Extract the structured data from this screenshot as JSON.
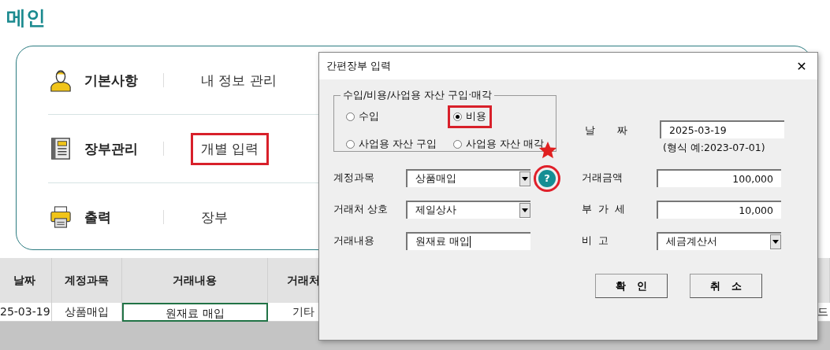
{
  "page_title": "메인",
  "menu": [
    {
      "kind": "person",
      "category": "기본사항",
      "item": "내 정보 관리",
      "highlighted": false
    },
    {
      "kind": "notebook",
      "category": "장부관리",
      "item": "개별 입력",
      "highlighted": true
    },
    {
      "kind": "printer",
      "category": "출력",
      "item": "장부",
      "highlighted": false
    }
  ],
  "sheet": {
    "columns": [
      "날짜",
      "계정과목",
      "거래내용",
      "거래처"
    ],
    "row": [
      {
        "text": "25-03-19",
        "selected": false
      },
      {
        "text": "상품매입",
        "selected": false
      },
      {
        "text": "원재료 매입",
        "selected": true
      },
      {
        "text": "기타",
        "selected": false
      }
    ],
    "right_cell": "드"
  },
  "dialog": {
    "title": "간편장부 입력",
    "close": "✕",
    "group": {
      "title": "수입/비용/사업용 자산 구입·매각",
      "options": [
        {
          "label": "수입",
          "selected": false,
          "highlighted": false
        },
        {
          "label": "비용",
          "selected": true,
          "highlighted": true
        },
        {
          "label": "사업용 자산 구입",
          "selected": false,
          "highlighted": false
        },
        {
          "label": "사업용 자산 매각",
          "selected": false,
          "highlighted": false
        }
      ]
    },
    "date": {
      "label": "날 짜",
      "value": "2025-03-19",
      "hint": "(형식 예:2023-07-01)"
    },
    "help": {
      "text": "?",
      "circled": true,
      "starred": true
    },
    "left_fields": [
      {
        "kind": "combo",
        "label": "계정과목",
        "value": "상품매입"
      },
      {
        "kind": "combo",
        "label": "거래처 상호",
        "value": "제일상사"
      },
      {
        "kind": "text",
        "label": "거래내용",
        "value": "원재료 매입"
      }
    ],
    "right_fields": [
      {
        "kind": "number",
        "label": "거래금액",
        "value": "100,000"
      },
      {
        "kind": "number",
        "label": "부 가 세",
        "value": "10,000"
      },
      {
        "kind": "combo",
        "label": "비 고",
        "value": "세금계산서"
      }
    ],
    "buttons": [
      "확 인",
      "취 소"
    ]
  }
}
